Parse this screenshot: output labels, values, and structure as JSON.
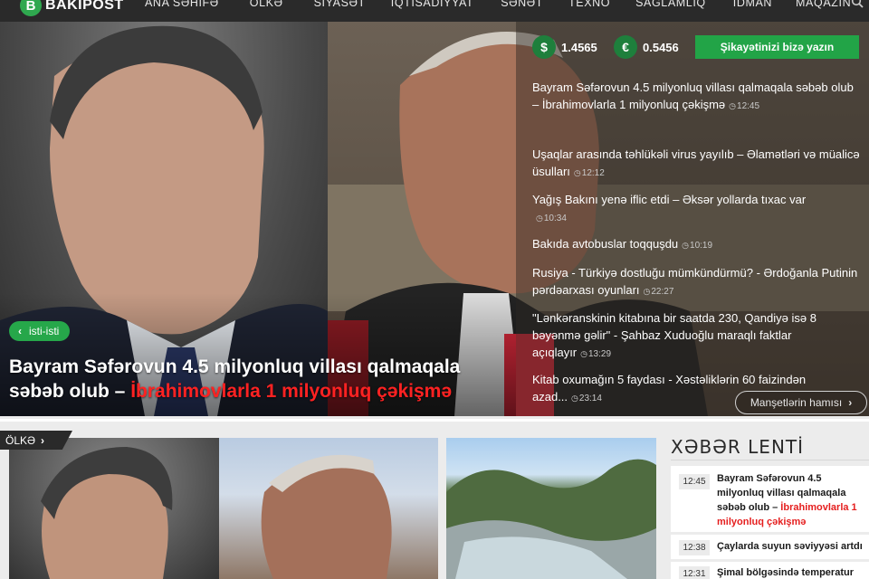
{
  "brand": {
    "logo_letter": "B",
    "name": "BAKIPOST",
    "accent_color": "#26a74a",
    "highlight_color": "#ff2222"
  },
  "nav": {
    "items": [
      {
        "label": "ANA SƏHİFƏ"
      },
      {
        "label": "ÖLKƏ"
      },
      {
        "label": "SİYASƏT"
      },
      {
        "label": "İQTİSADİYYAT"
      },
      {
        "label": "SƏNƏT"
      },
      {
        "label": "TEXNO"
      },
      {
        "label": "SAĞLAMLIQ"
      },
      {
        "label": "İDMAN"
      },
      {
        "label": "MAQAZİN"
      }
    ],
    "search_icon": "search-icon"
  },
  "currency": {
    "usd_symbol": "$",
    "usd_value": "1.4565",
    "eur_symbol": "€",
    "eur_value": "0.5456"
  },
  "complaint_button": "Şikayətinizi bizə yazın",
  "hero": {
    "tag": "isti-isti",
    "headline_main": "Bayram Səfərovun 4.5 milyonluq villası qalmaqala səbəb olub – ",
    "headline_red": "İbrahimovlarla 1 milyonluq çəkişmə"
  },
  "headlines": [
    {
      "text": "Bayram Səfərovun 4.5 milyonluq villası qalmaqala səbəb olub – İbrahimovlarla 1 milyonluq çəkişmə",
      "time": "12:45"
    },
    {
      "text": "Uşaqlar arasında təhlükəli virus yayılıb – Əlamətləri və müalicə üsulları",
      "time": "12:12"
    },
    {
      "text": "Yağış Bakını yenə iflic etdi – Əksər yollarda tıxac var",
      "time": "10:34"
    },
    {
      "text": "Bakıda avtobuslar toqquşdu",
      "time": "10:19"
    },
    {
      "text": "Rusiya - Türkiyə dostluğu mümkündürmü? - Ərdoğanla Putinin pərdəarxası oyunları",
      "time": "22:27"
    },
    {
      "text": "\"Lənkəranskinin kitabına bir saatda 230, Qandiyə isə 8 bəyənmə gəlir\" - Şahbaz Xuduoğlu maraqlı faktlar açıqlayır",
      "time": "13:29"
    },
    {
      "text": "Kitab oxumağın 5 faydası - Xəstəliklərin 60 faizindən azad...",
      "time": "23:14"
    }
  ],
  "more_headlines": "Manşetlərin hamısı",
  "section": {
    "tab": "ÖLKƏ"
  },
  "feed": {
    "title": "XƏBƏR LENTİ",
    "items": [
      {
        "time": "12:45",
        "text": "Bayram Səfərovun 4.5 milyonluq villası qalmaqala səbəb olub – ",
        "red": "İbrahimovlarla 1 milyonluq çəkişmə"
      },
      {
        "time": "12:38",
        "text": "Çaylarda suyun səviyyəsi artdı",
        "red": ""
      },
      {
        "time": "12:31",
        "text": "Şimal bölgəsində temperatur",
        "red": ""
      }
    ]
  }
}
